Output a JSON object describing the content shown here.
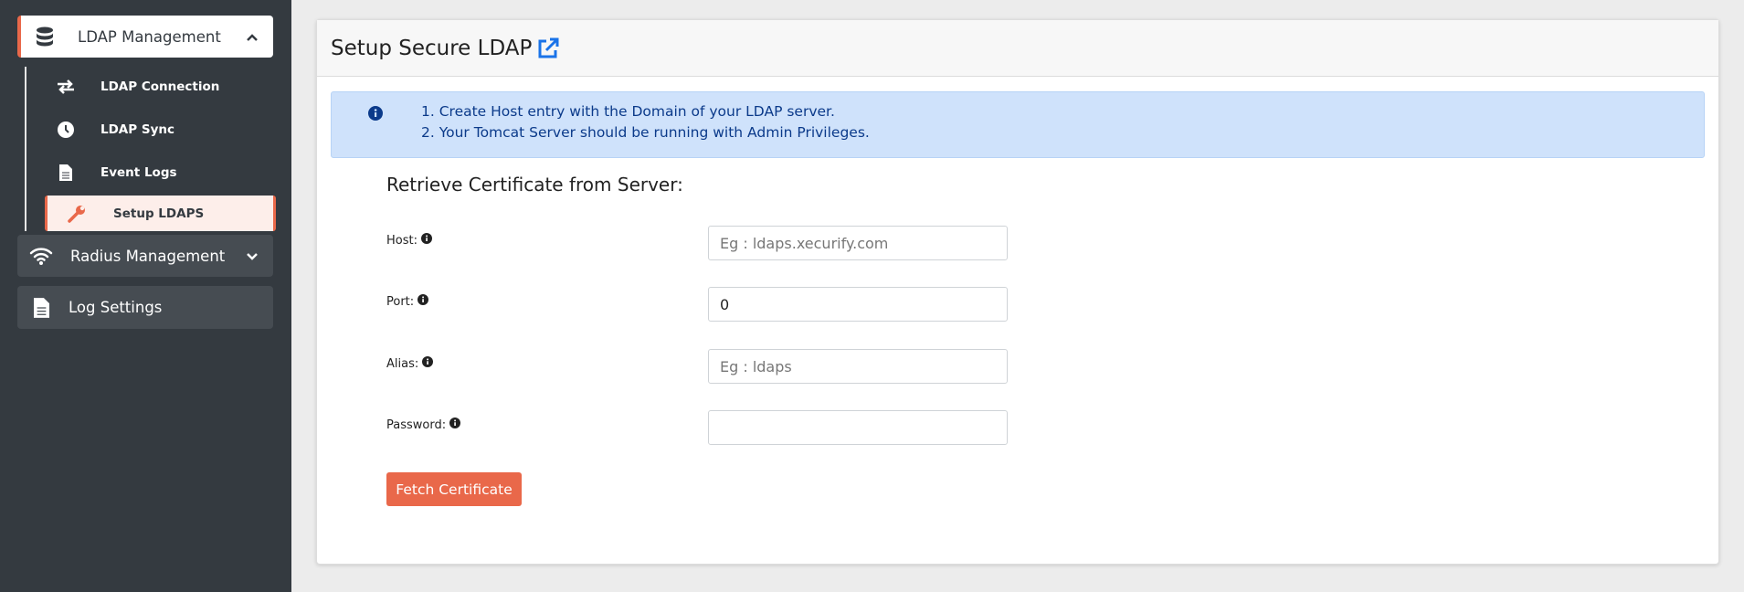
{
  "sidebar": {
    "ldap_management": "LDAP Management",
    "sub_items": [
      {
        "label": "LDAP Connection"
      },
      {
        "label": "LDAP Sync"
      },
      {
        "label": "Event Logs"
      },
      {
        "label": "Setup LDAPS"
      }
    ],
    "radius_management": "Radius Management",
    "log_settings": "Log Settings"
  },
  "card": {
    "title": "Setup Secure LDAP",
    "alert": [
      "1. Create Host entry with the Domain of your LDAP server.",
      "2. Your Tomcat Server should be running with Admin Privileges."
    ],
    "section_title": "Retrieve Certificate from Server:",
    "fields": {
      "host": {
        "label": "Host:",
        "value": "",
        "placeholder": "Eg : ldaps.xecurify.com"
      },
      "port": {
        "label": "Port:",
        "value": "0",
        "placeholder": ""
      },
      "alias": {
        "label": "Alias:",
        "value": "",
        "placeholder": "Eg : ldaps"
      },
      "password": {
        "label": "Password:",
        "value": "",
        "placeholder": ""
      }
    },
    "fetch_button": "Fetch Certificate"
  },
  "colors": {
    "accent": "#e9684a",
    "sidebar_bg": "#343a40",
    "link": "#1a73e8"
  }
}
